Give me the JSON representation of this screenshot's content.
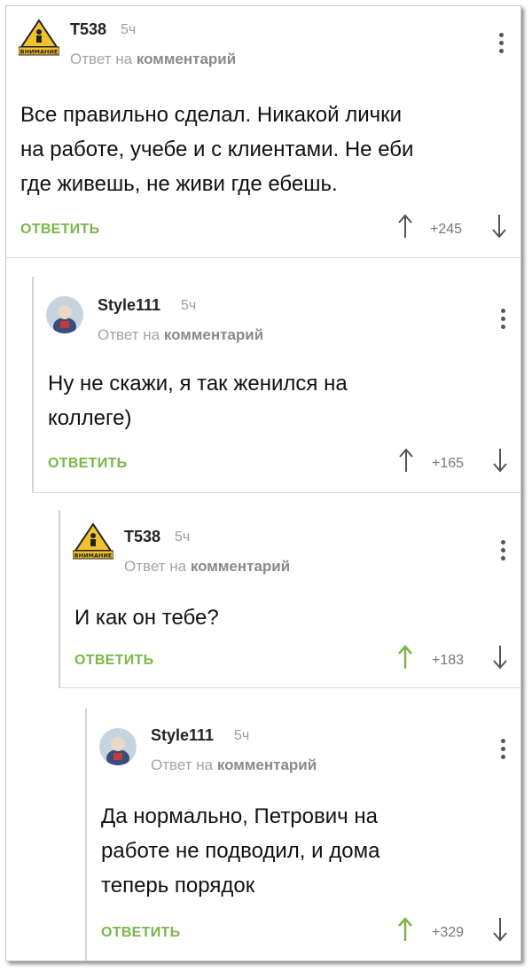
{
  "comments": [
    {
      "username": "T538",
      "time": "5ч",
      "reply_prefix": "Ответ на",
      "reply_target": "комментарий",
      "text_lines": [
        "Все правильно сделал. Никакой лички",
        "на работе, учебе и с клиентами. Не еби",
        "где живешь, не живи где ебешь."
      ],
      "reply_label": "ОТВЕТИТЬ",
      "score": "+245",
      "avatar_text": "ВНИМАНИЕ",
      "upvoted": false
    },
    {
      "username": "Style111",
      "time": "5ч",
      "reply_prefix": "Ответ на",
      "reply_target": "комментарий",
      "text_lines": [
        "Ну не скажи, я так женился на",
        "коллеге)"
      ],
      "reply_label": "ОТВЕТИТЬ",
      "score": "+165",
      "upvoted": false
    },
    {
      "username": "T538",
      "time": "5ч",
      "reply_prefix": "Ответ на",
      "reply_target": "комментарий",
      "text_lines": [
        "И как он тебе?"
      ],
      "reply_label": "ОТВЕТИТЬ",
      "score": "+183",
      "avatar_text": "ВНИМАНИЕ",
      "upvoted": true
    },
    {
      "username": "Style111",
      "time": "5ч",
      "reply_prefix": "Ответ на",
      "reply_target": "комментарий",
      "text_lines": [
        "Да нормально, Петрович на",
        "работе не подводил, и дома",
        "теперь порядок"
      ],
      "reply_label": "ОТВЕТИТЬ",
      "score": "+329",
      "upvoted": true
    }
  ],
  "colors": {
    "accent_green": "#7ab648",
    "muted_gray": "#9a9a9a",
    "arrow_gray": "#555555"
  },
  "icons": {
    "upvote": "arrow-up-icon",
    "downvote": "arrow-down-icon",
    "menu": "more-vertical-icon",
    "warning_avatar": "warning-sign-avatar",
    "photo_avatar": "user-photo-avatar"
  }
}
